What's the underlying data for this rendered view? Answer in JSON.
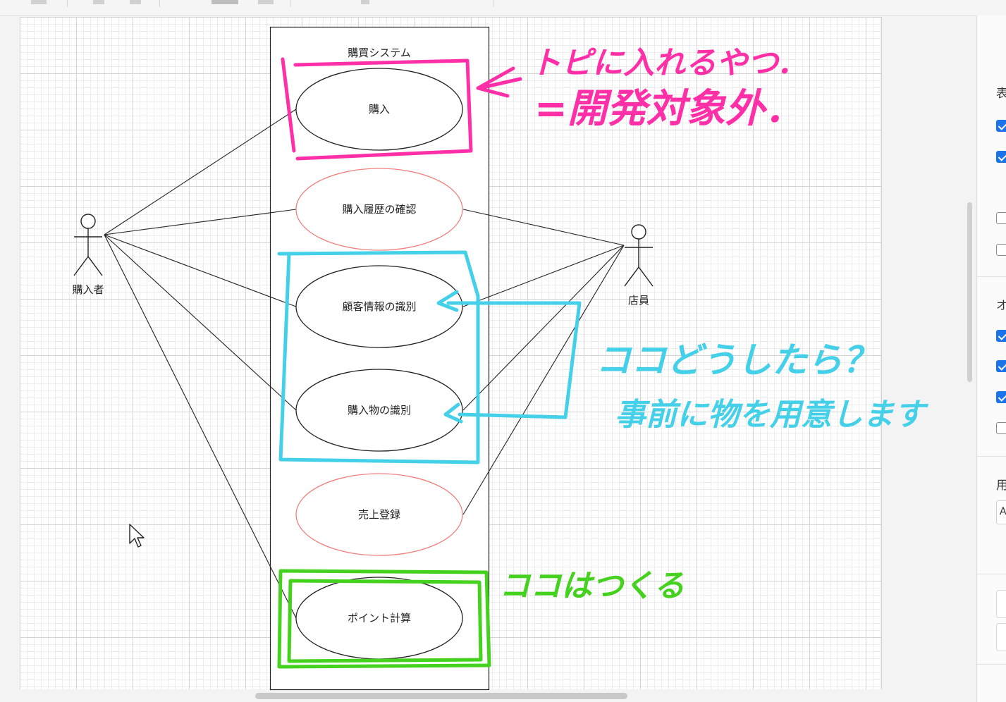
{
  "diagram": {
    "system_title": "購買システム",
    "actors": {
      "buyer": "購入者",
      "clerk": "店員"
    },
    "use_cases": [
      {
        "id": "purchase",
        "label": "購入",
        "border": "#222222"
      },
      {
        "id": "history",
        "label": "購入履歴の確認",
        "border": "#f08080"
      },
      {
        "id": "customer_id",
        "label": "顧客情報の識別",
        "border": "#222222"
      },
      {
        "id": "item_id",
        "label": "購入物の識別",
        "border": "#222222"
      },
      {
        "id": "sales",
        "label": "売上登録",
        "border": "#f08080"
      },
      {
        "id": "points",
        "label": "ポイント計算",
        "border": "#222222"
      }
    ]
  },
  "annotations": {
    "pink": {
      "color": "#ff2fa8",
      "text1": "トピに入れるやつ．",
      "text2": "=開発対象外．"
    },
    "cyan": {
      "color": "#44d0e8",
      "text1": "ココどうしたら？",
      "text2": "事前に物を用意します"
    },
    "green": {
      "color": "#45d21e",
      "text": "ココはつくる"
    }
  },
  "right_panel": {
    "section_labels": [
      "表",
      "オ",
      "用"
    ],
    "field_value": "A",
    "checkboxes": [
      true,
      true,
      false,
      false,
      true,
      true,
      true,
      false
    ]
  }
}
